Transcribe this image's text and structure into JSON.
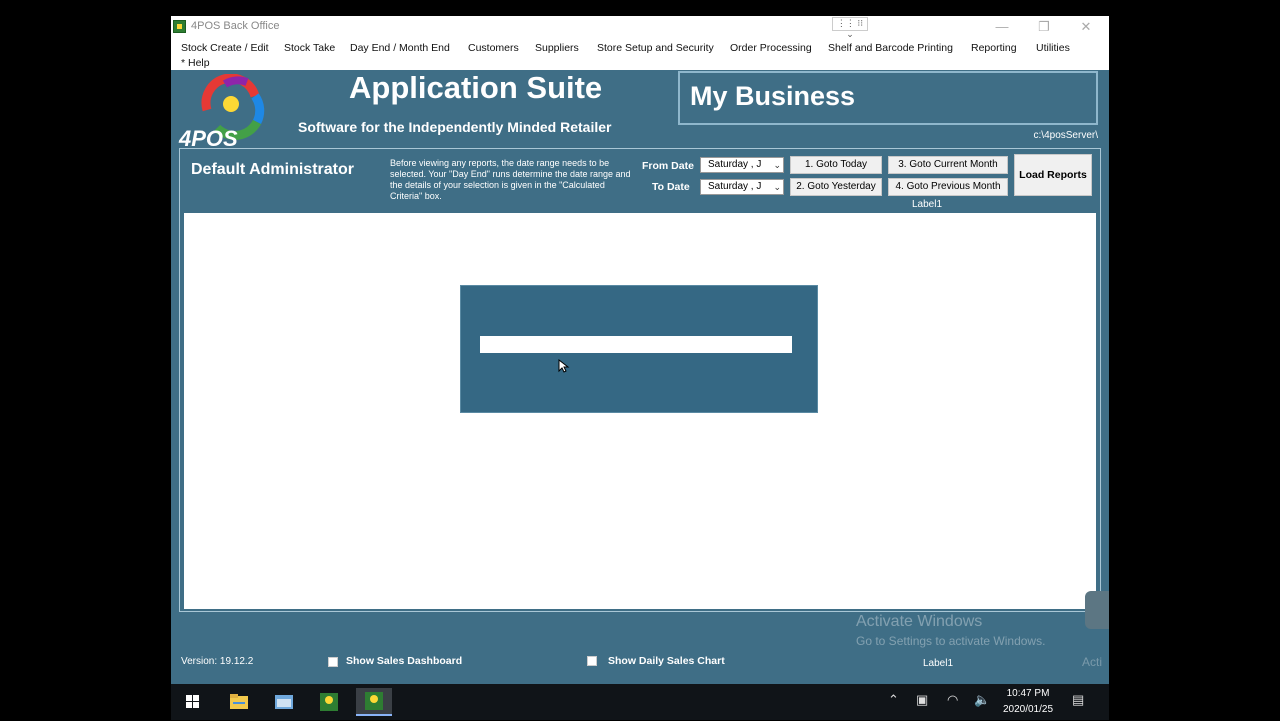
{
  "window": {
    "title": "4POS Back Office",
    "title_tools": "⋮⋮ ⁝⁝ ⌄",
    "controls": [
      "—",
      "❐",
      "✕"
    ]
  },
  "menu": [
    "Stock Create / Edit",
    "Stock Take",
    "Day End / Month End",
    "Customers",
    "Suppliers",
    "Store Setup and Security",
    "Order Processing",
    "Shelf and Barcode Printing",
    "Reporting",
    "Utilities",
    "* Help"
  ],
  "header": {
    "logo_text": "4POS",
    "app_title": "Application Suite",
    "subtitle": "Software for the Independently Minded Retailer",
    "business_name": "My Business",
    "server_path": "c:\\4posServer\\"
  },
  "controls_bar": {
    "admin_name": "Default Administrator",
    "info_text": "Before viewing any reports, the date range needs to be selected. Your \"Day End\" runs determine the date range and the details of your selection is given in the \"Calculated Criteria\" box.",
    "from_label": "From Date",
    "to_label": "To Date",
    "from_value": "Saturday  ,  J",
    "to_value": "Saturday  ,  J",
    "btn_today": "1. Goto Today",
    "btn_yesterday": "2. Goto Yesterday",
    "btn_current_month": "3. Goto Current Month",
    "btn_previous_month": "4. Goto Previous Month",
    "btn_load": "Load Reports",
    "label1": "Label1"
  },
  "footer": {
    "version": "Version: 19.12.2",
    "show_sales_dashboard": "Show Sales Dashboard",
    "show_daily_sales_chart": "Show Daily Sales Chart",
    "label1": "Label1",
    "activate_title": "Activate Windows",
    "activate_sub": "Go to Settings to activate Windows.",
    "activate_edge": "Acti"
  },
  "taskbar": {
    "time": "10:47 PM",
    "date": "2020/01/25"
  },
  "colors": {
    "background": "#3f6e86",
    "dialog": "#356884",
    "content": "#ffffff"
  }
}
